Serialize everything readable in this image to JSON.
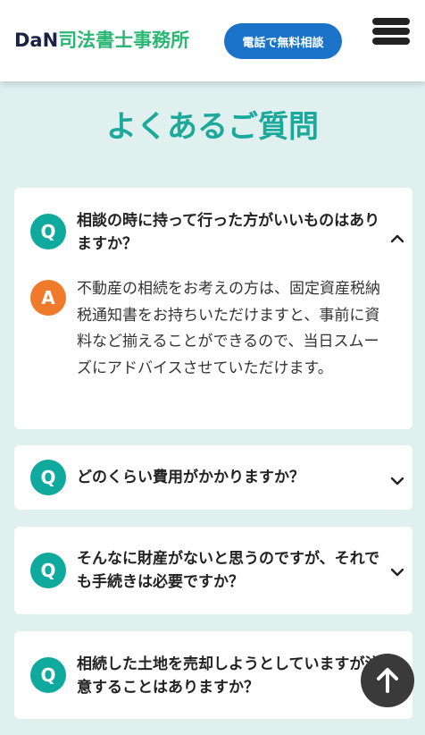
{
  "header": {
    "logo_brand": "DaN",
    "logo_rest": "司法書士事務所",
    "cta_label": "電話で無料相談",
    "menu_icon": "hamburger-icon"
  },
  "section_title": "よくあるご質問",
  "faq": [
    {
      "q_mark": "Q",
      "question": "相談の時に持って行った方がいいものはありますか？",
      "a_mark": "A",
      "answer": "不動産の相続をお考えの方は、固定資産税納税通知書をお持ちいただけますと、事前に資料など揃えることができるので、当日スムーズにアドバイスさせていただけます。",
      "expanded": true
    },
    {
      "q_mark": "Q",
      "question": "どのくらい費用がかかりますか？",
      "expanded": false
    },
    {
      "q_mark": "Q",
      "question": "そんなに財産がないと思うのですが、それでも手続きは必要ですか？",
      "expanded": false
    },
    {
      "q_mark": "Q",
      "question": "相続した土地を売却しようとしていますが注意することはありますか？",
      "expanded": false
    }
  ],
  "back_to_top_icon": "arrow-up-icon",
  "colors": {
    "accent": "#1aa99b",
    "q_badge": "#0fa99d",
    "a_badge": "#f07a2b",
    "cta": "#1a73c9",
    "logo_green": "#2bb673"
  }
}
